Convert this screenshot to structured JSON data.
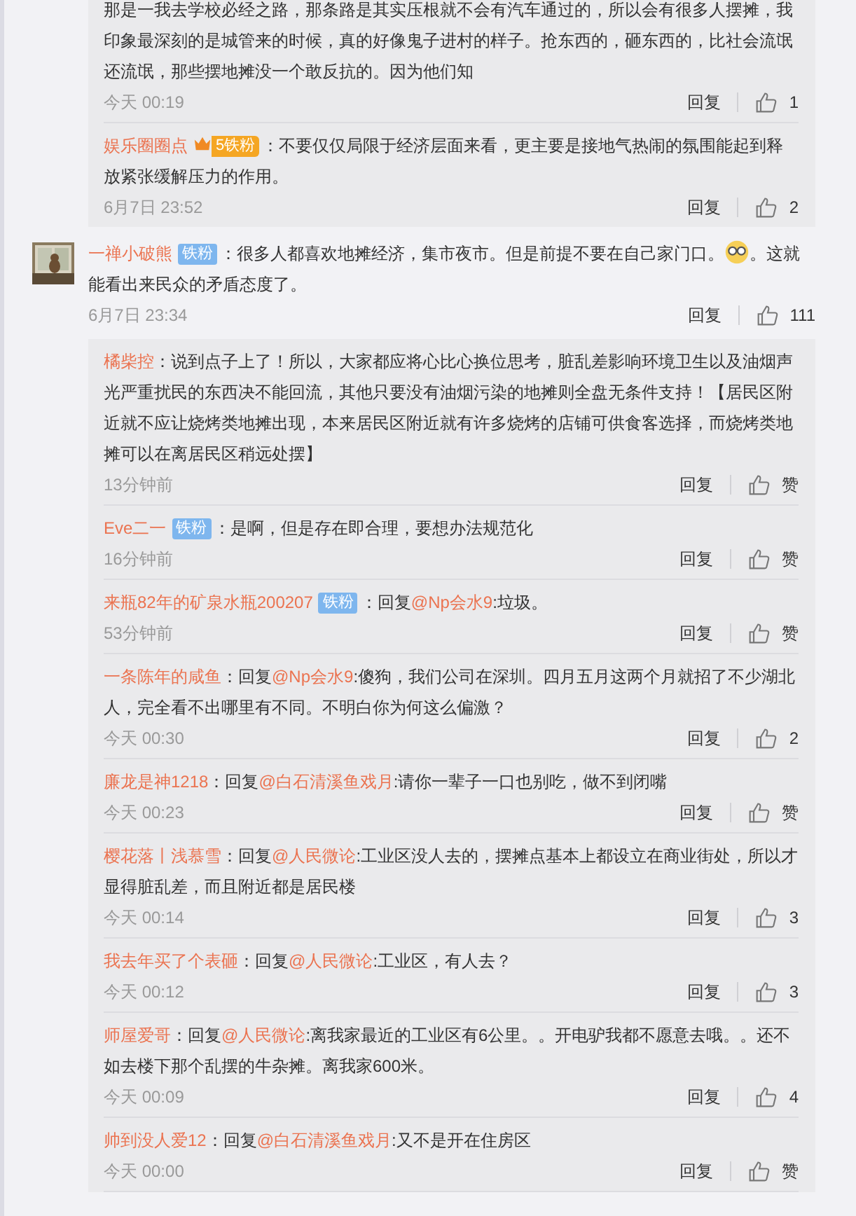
{
  "top_replies": [
    {
      "parts": [
        {
          "kind": "text",
          "text": "那是一我去学校必经之路，那条路是其实压根就不会有汽车通过的，所以会有很多人摆摊，我印象最深刻的是城管来的时候，真的好像鬼子进村的样子。抢东西的，砸东西的，比社会流氓还流氓，那些摆地摊没一个敢反抗的。因为他们知"
        }
      ],
      "time": "今天 00:19",
      "reply": "回复",
      "likes": "1"
    },
    {
      "user": "娱乐圈圈点",
      "badges": [
        {
          "kind": "crown",
          "rank": "5",
          "label": "铁粉",
          "color": "#f5a623"
        }
      ],
      "parts": [
        {
          "kind": "text",
          "text": "：不要仅仅局限于经济层面来看，更主要是接地气热闹的氛围能起到释放紧张缓解压力的作用。"
        }
      ],
      "time": "6月7日 23:52",
      "reply": "回复",
      "likes": "2"
    }
  ],
  "comment": {
    "user": "一禅小破熊",
    "badges": [
      {
        "kind": "plain",
        "label": "铁粉",
        "color": "#7eb6ee"
      }
    ],
    "parts": [
      {
        "kind": "text",
        "text": "：很多人都喜欢地摊经济，集市夜市。但是前提不要在自己家门口。"
      },
      {
        "kind": "emoji"
      },
      {
        "kind": "text",
        "text": "。这就能看出来民众的矛盾态度了。"
      }
    ],
    "time": "6月7日 23:34",
    "reply": "回复",
    "likes": "111"
  },
  "replies": [
    {
      "user": "橘柴控",
      "parts": [
        {
          "kind": "text",
          "text": "：说到点子上了！所以，大家都应将心比心换位思考，脏乱差影响环境卫生以及油烟声光严重扰民的东西决不能回流，其他只要没有油烟污染的地摊则全盘无条件支持！【居民区附近就不应让烧烤类地摊出现，本来居民区附近就有许多烧烤的店铺可供食客选择，而烧烤类地摊可以在离居民区稍远处摆】"
        }
      ],
      "time": "13分钟前",
      "reply": "回复",
      "likes": "赞"
    },
    {
      "user": "Eve二一",
      "badges": [
        {
          "kind": "plain",
          "label": "铁粉",
          "color": "#7eb6ee"
        }
      ],
      "parts": [
        {
          "kind": "text",
          "text": "：是啊，但是存在即合理，要想办法规范化"
        }
      ],
      "time": "16分钟前",
      "reply": "回复",
      "likes": "赞"
    },
    {
      "user": "来瓶82年的矿泉水瓶200207",
      "badges": [
        {
          "kind": "plain",
          "label": "铁粉",
          "color": "#7eb6ee"
        }
      ],
      "parts": [
        {
          "kind": "text",
          "text": "：回复"
        },
        {
          "kind": "mention",
          "text": "@Np会水9"
        },
        {
          "kind": "text",
          "text": ":垃圾。"
        }
      ],
      "time": "53分钟前",
      "reply": "回复",
      "likes": "赞"
    },
    {
      "user": "一条陈年的咸鱼",
      "parts": [
        {
          "kind": "text",
          "text": "：回复"
        },
        {
          "kind": "mention",
          "text": "@Np会水9"
        },
        {
          "kind": "text",
          "text": ":傻狗，我们公司在深圳。四月五月这两个月就招了不少湖北人，完全看不出哪里有不同。不明白你为何这么偏激？"
        }
      ],
      "time": "今天 00:30",
      "reply": "回复",
      "likes": "2"
    },
    {
      "user": "廉龙是神1218",
      "parts": [
        {
          "kind": "text",
          "text": "：回复"
        },
        {
          "kind": "mention",
          "text": "@白石清溪鱼戏月"
        },
        {
          "kind": "text",
          "text": ":请你一辈子一口也别吃，做不到闭嘴"
        }
      ],
      "time": "今天 00:23",
      "reply": "回复",
      "likes": "赞"
    },
    {
      "user": "樱花落丨浅慕雪",
      "parts": [
        {
          "kind": "text",
          "text": "：回复"
        },
        {
          "kind": "mention",
          "text": "@人民微论"
        },
        {
          "kind": "text",
          "text": ":工业区没人去的，摆摊点基本上都设立在商业街处，所以才显得脏乱差，而且附近都是居民楼"
        }
      ],
      "time": "今天 00:14",
      "reply": "回复",
      "likes": "3"
    },
    {
      "user": "我去年买了个表砸",
      "parts": [
        {
          "kind": "text",
          "text": "：回复"
        },
        {
          "kind": "mention",
          "text": "@人民微论"
        },
        {
          "kind": "text",
          "text": ":工业区，有人去？"
        }
      ],
      "time": "今天 00:12",
      "reply": "回复",
      "likes": "3"
    },
    {
      "user": "师屋爱哥",
      "parts": [
        {
          "kind": "text",
          "text": "：回复"
        },
        {
          "kind": "mention",
          "text": "@人民微论"
        },
        {
          "kind": "text",
          "text": ":离我家最近的工业区有6公里。。开电驴我都不愿意去哦。。还不如去楼下那个乱摆的牛杂摊。离我家600米。"
        }
      ],
      "time": "今天 00:09",
      "reply": "回复",
      "likes": "4"
    },
    {
      "user": "帅到没人爱12",
      "parts": [
        {
          "kind": "text",
          "text": "：回复"
        },
        {
          "kind": "mention",
          "text": "@白石清溪鱼戏月"
        },
        {
          "kind": "text",
          "text": ":又不是开在住房区"
        }
      ],
      "time": "今天 00:00",
      "reply": "回复",
      "likes": "赞"
    }
  ]
}
